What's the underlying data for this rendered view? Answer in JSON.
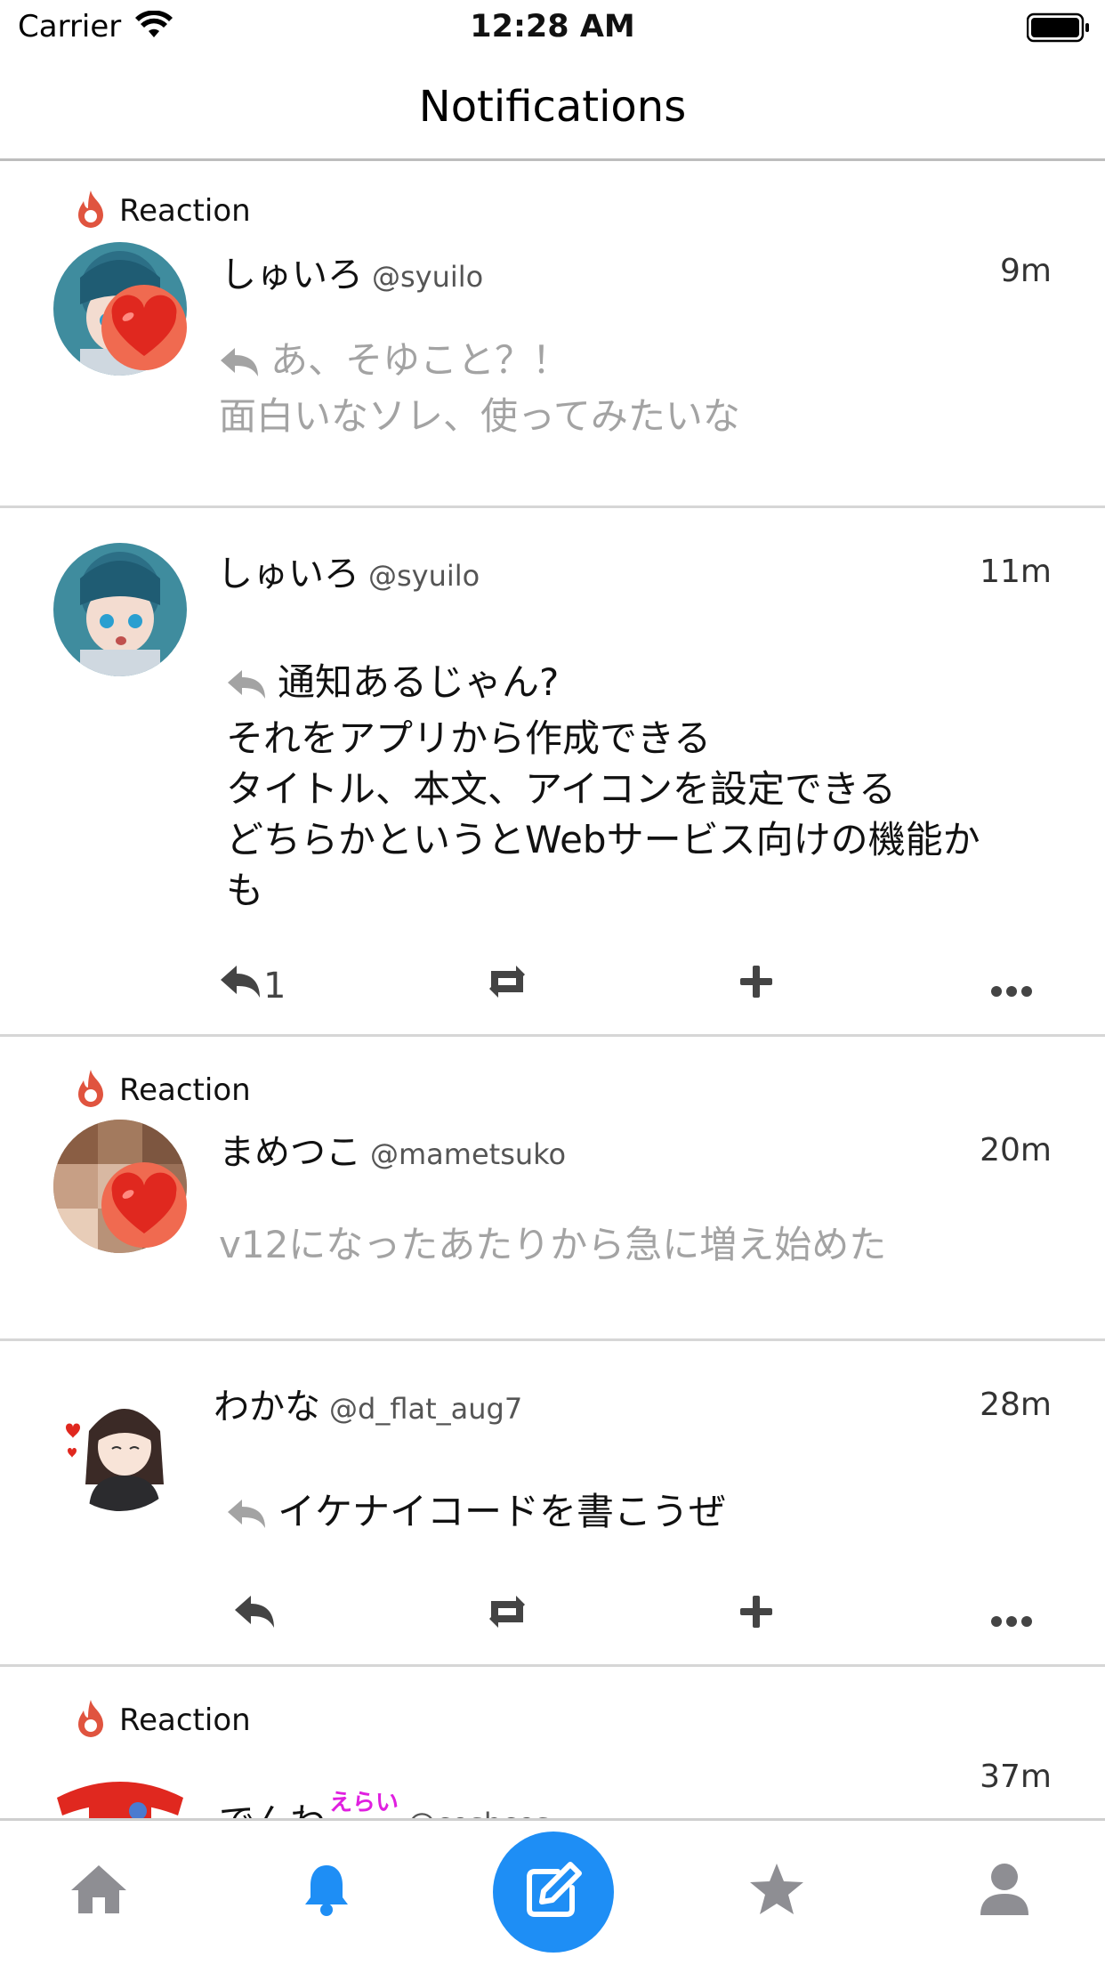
{
  "status_bar": {
    "carrier": "Carrier",
    "time": "12:28 AM"
  },
  "nav": {
    "title": "Notifications"
  },
  "notifications": [
    {
      "type": "reaction",
      "label": "Reaction",
      "name": "しゅいろ",
      "handle": "@syuilo",
      "time": "9m",
      "text_lines": [
        "あ、そゆこと？！",
        "面白いなソレ、使ってみたいな"
      ]
    },
    {
      "type": "reply",
      "name": "しゅいろ",
      "handle": "@syuilo",
      "time": "11m",
      "text_lines": [
        "通知あるじゃん?",
        "それをアプリから作成できる",
        "タイトル、本文、アイコンを設定できる",
        "どちらかというとWebサービス向けの機能か",
        "も"
      ],
      "reply_count": "1"
    },
    {
      "type": "reaction",
      "label": "Reaction",
      "name": "まめつこ",
      "handle": "@mametsuko",
      "time": "20m",
      "text_lines": [
        "v12になったあたりから急に増え始めた"
      ]
    },
    {
      "type": "reply",
      "name": "わかな",
      "handle": "@d_flat_aug7",
      "time": "28m",
      "text_lines": [
        "イケナイコードを書こうぜ"
      ],
      "reply_count": ""
    },
    {
      "type": "reaction",
      "label": "Reaction",
      "name": "でんわ",
      "name_emoji": "えらい",
      "handle": "@coshces",
      "time": "37m"
    }
  ],
  "colors": {
    "accent": "#1e8ef5",
    "fire": "#e0543f",
    "heart": "#e0281f",
    "gray_text": "#a3a3a3"
  },
  "tabs": [
    "home-icon",
    "bell-icon",
    "compose-icon",
    "star-icon",
    "user-icon"
  ]
}
